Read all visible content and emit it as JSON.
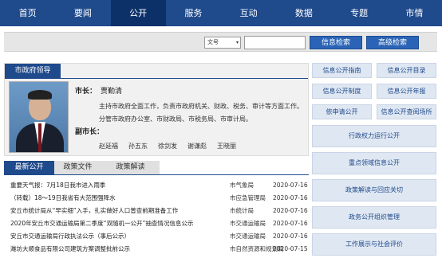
{
  "nav": [
    "首页",
    "要闻",
    "公开",
    "服务",
    "互动",
    "数据",
    "专题",
    "市情"
  ],
  "search": {
    "select_value": "文号",
    "info_search_label": "信息检索",
    "adv_search_label": "高级检索"
  },
  "leader": {
    "tab_label": "市政府领导",
    "mayor_label": "市长：",
    "mayor_name": "贾勤清",
    "duty1": "主持市政府全面工作，负责市政府机关、财政、税务、审计等方面工作。",
    "duty2": "分管市政府办公室、市财政局、市税务局、市审计局。",
    "vice_label": "副市长：",
    "vice_names": [
      "赵延福",
      "孙五东",
      "徐剑发",
      "谢谦彪",
      "王晓丽"
    ]
  },
  "news_tabs": [
    "最新公开",
    "政策文件",
    "政策解读"
  ],
  "news": [
    {
      "title": "重要天气报：7月18日我市进入雨季",
      "source": "市气象局",
      "date": "2020-07-16"
    },
    {
      "title": "（转载）18～19日我省有大范围强降水",
      "source": "市应急管理局",
      "date": "2020-07-16"
    },
    {
      "title": "安丘市统计局从“早实细”入手，扎实做好人口普查前期准备工作",
      "source": "市统计局",
      "date": "2020-07-16"
    },
    {
      "title": "2020年安丘市交通运输局第二季度“双随机一公开”抽查情况信息公示",
      "source": "市交通运输局",
      "date": "2020-07-16"
    },
    {
      "title": "安丘市交通运输局行政执法公示（事后公示）",
      "source": "市交通运输局",
      "date": "2020-07-16"
    },
    {
      "title": "潍坊大顺食品有限公司建筑方案调整批前公示",
      "source": "市自然资源和规划局",
      "date": "2020-07-15"
    }
  ],
  "right_small": [
    "信息公开指南",
    "信息公开目录",
    "信息公开制度",
    "信息公开年报",
    "依申请公开",
    "信息公开查阅场所"
  ],
  "right_wide": [
    "行政权力运行公开",
    "重点领域信息公开",
    "政策解读与回应关切",
    "政务公开组织管理",
    "工作展示与社会评价"
  ]
}
